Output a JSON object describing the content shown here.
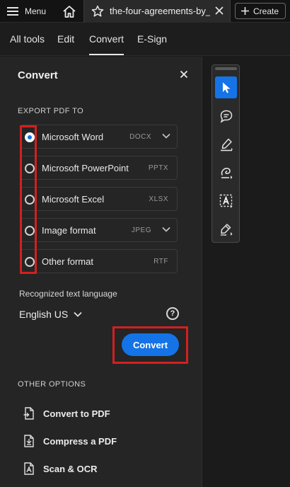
{
  "topbar": {
    "menu_label": "Menu",
    "tab_title": "the-four-agreements-by_",
    "create_label": "Create"
  },
  "nav": {
    "items": [
      {
        "label": "All tools"
      },
      {
        "label": "Edit"
      },
      {
        "label": "Convert"
      },
      {
        "label": "E-Sign"
      }
    ],
    "active": "Convert"
  },
  "panel": {
    "title": "Convert",
    "export_heading": "EXPORT PDF TO",
    "formats": [
      {
        "label": "Microsoft Word",
        "ext": "DOCX",
        "checked": true,
        "dropdown": true
      },
      {
        "label": "Microsoft PowerPoint",
        "ext": "PPTX",
        "checked": false,
        "dropdown": false
      },
      {
        "label": "Microsoft Excel",
        "ext": "XLSX",
        "checked": false,
        "dropdown": false
      },
      {
        "label": "Image format",
        "ext": "JPEG",
        "checked": false,
        "dropdown": true
      },
      {
        "label": "Other format",
        "ext": "RTF",
        "checked": false,
        "dropdown": false
      }
    ],
    "language_label": "Recognized text language",
    "language_value": "English US",
    "help_glyph": "?",
    "convert_button": "Convert",
    "other_heading": "OTHER OPTIONS",
    "other_options": [
      {
        "label": "Convert to PDF",
        "icon": "convert-to-pdf-icon"
      },
      {
        "label": "Compress a PDF",
        "icon": "compress-pdf-icon"
      },
      {
        "label": "Scan & OCR",
        "icon": "scan-ocr-icon"
      }
    ]
  },
  "toolbar": {
    "tools": [
      {
        "icon": "select-cursor-icon",
        "active": true
      },
      {
        "icon": "add-comment-icon",
        "active": false
      },
      {
        "icon": "highlight-pen-icon",
        "active": false
      },
      {
        "icon": "freehand-draw-icon",
        "active": false
      },
      {
        "icon": "text-recognition-icon",
        "active": false
      },
      {
        "icon": "sign-pen-icon",
        "active": false
      }
    ]
  },
  "colors": {
    "accent": "#1473e6",
    "highlight_box": "#d41f1f",
    "panel_bg": "#252525"
  }
}
